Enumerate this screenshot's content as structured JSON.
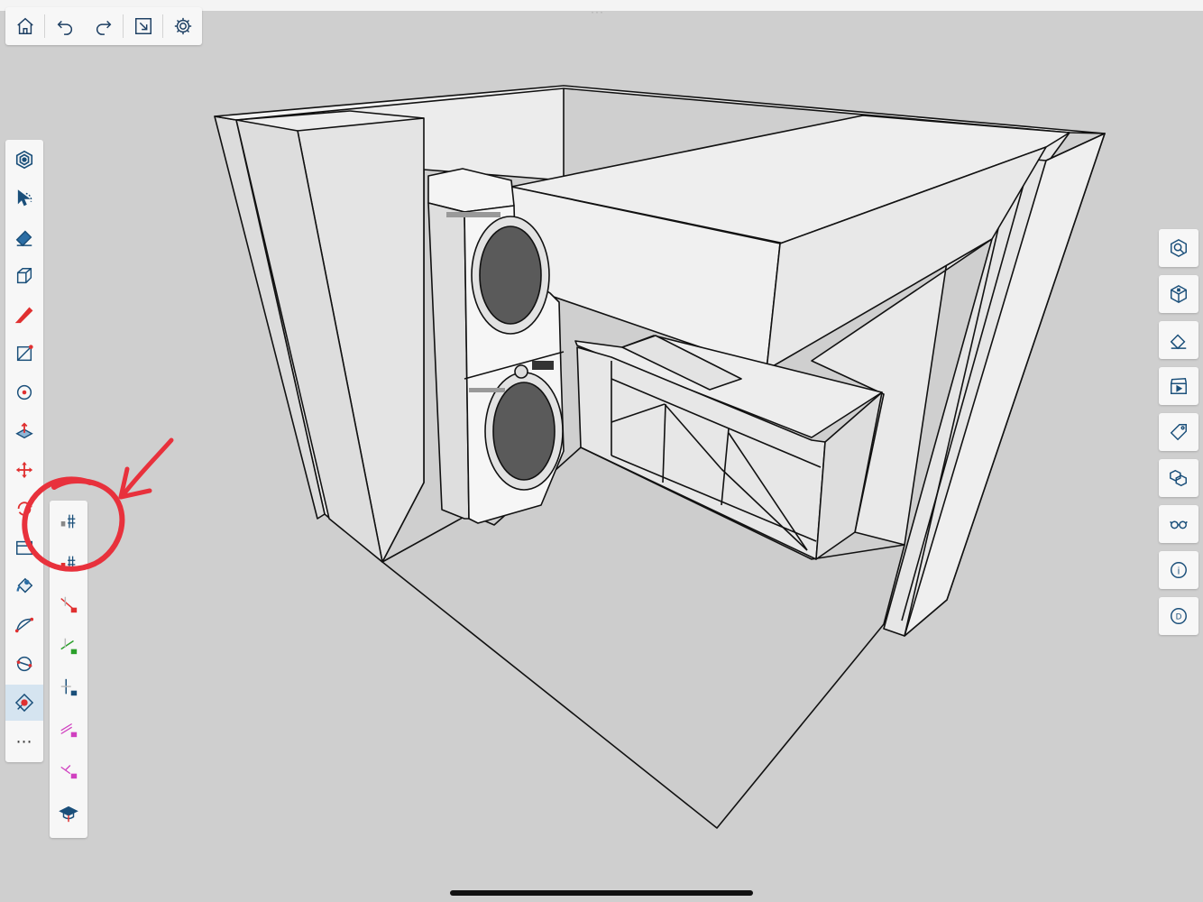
{
  "app": {
    "grabber": "···"
  },
  "top_toolbar": {
    "buttons": [
      {
        "icon": "home-icon"
      },
      {
        "icon": "undo-icon"
      },
      {
        "icon": "redo-icon"
      },
      {
        "icon": "export-icon"
      },
      {
        "icon": "settings-gear-icon"
      }
    ]
  },
  "left_toolbar": {
    "tools": [
      {
        "icon": "view-cube-icon"
      },
      {
        "icon": "select-tool-icon"
      },
      {
        "icon": "eraser-icon"
      },
      {
        "icon": "component-box-icon"
      },
      {
        "icon": "pencil-line-icon"
      },
      {
        "icon": "rectangle-tool-icon"
      },
      {
        "icon": "circle-tool-icon"
      },
      {
        "icon": "push-pull-icon"
      },
      {
        "icon": "move-tool-icon"
      },
      {
        "icon": "rotate-tool-icon"
      },
      {
        "icon": "section-plane-icon"
      },
      {
        "icon": "paint-bucket-icon"
      },
      {
        "icon": "arc-tool-icon"
      },
      {
        "icon": "orbit-tool-icon"
      },
      {
        "icon": "snap-tool-icon"
      }
    ],
    "more_label": "⋯",
    "active_index": 14
  },
  "snap_flyout": {
    "items": [
      {
        "icon": "grid-snap-icon"
      },
      {
        "icon": "grid-snap-off-icon"
      },
      {
        "icon": "red-axis-lock-icon"
      },
      {
        "icon": "green-axis-lock-icon"
      },
      {
        "icon": "blue-axis-lock-icon"
      },
      {
        "icon": "parallel-lock-icon"
      },
      {
        "icon": "perpendicular-lock-icon"
      },
      {
        "icon": "learn-cap-icon"
      }
    ]
  },
  "right_toolbar": {
    "panels": [
      {
        "icon": "search-3d-icon"
      },
      {
        "icon": "components-cube-icon"
      },
      {
        "icon": "materials-eraser-icon"
      },
      {
        "icon": "scenes-clapper-icon"
      },
      {
        "icon": "tags-icon"
      },
      {
        "icon": "outliner-boxes-icon"
      },
      {
        "icon": "display-glasses-icon"
      },
      {
        "icon": "info-icon",
        "label": "i"
      },
      {
        "icon": "dimension-icon",
        "label": "D"
      }
    ]
  },
  "colors": {
    "accent_blue": "#1a4f7a",
    "snap_red": "#e03030",
    "axis_green": "#2aa02a",
    "magenta": "#d040c0",
    "annotation_red": "#e8313c"
  }
}
